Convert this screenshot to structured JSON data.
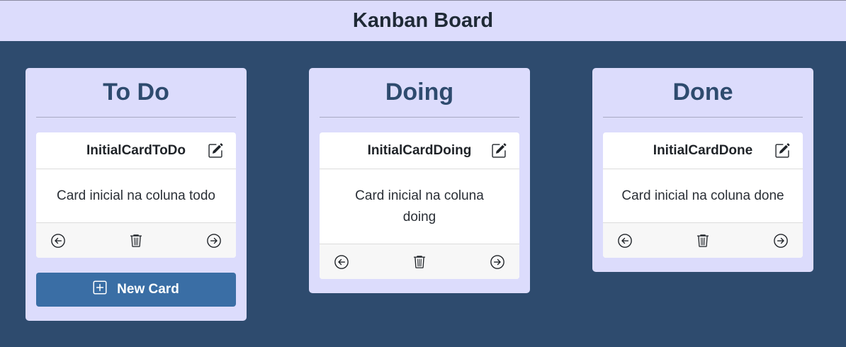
{
  "header": {
    "title": "Kanban Board"
  },
  "columns": [
    {
      "title": "To Do",
      "cards": [
        {
          "title": "InitialCardToDo",
          "body": "Card inicial na coluna todo"
        }
      ],
      "new_card_label": "New Card"
    },
    {
      "title": "Doing",
      "cards": [
        {
          "title": "InitialCardDoing",
          "body": "Card inicial na coluna doing"
        }
      ]
    },
    {
      "title": "Done",
      "cards": [
        {
          "title": "InitialCardDone",
          "body": "Card inicial na coluna done"
        }
      ]
    }
  ],
  "icons": {
    "edit": "edit-icon",
    "move_left": "arrow-left-circle-icon",
    "delete": "trash-icon",
    "move_right": "arrow-right-circle-icon",
    "new": "plus-square-icon"
  },
  "colors": {
    "background": "#2e4b6e",
    "column": "#dcdcfc",
    "accent": "#3a6ea5"
  }
}
